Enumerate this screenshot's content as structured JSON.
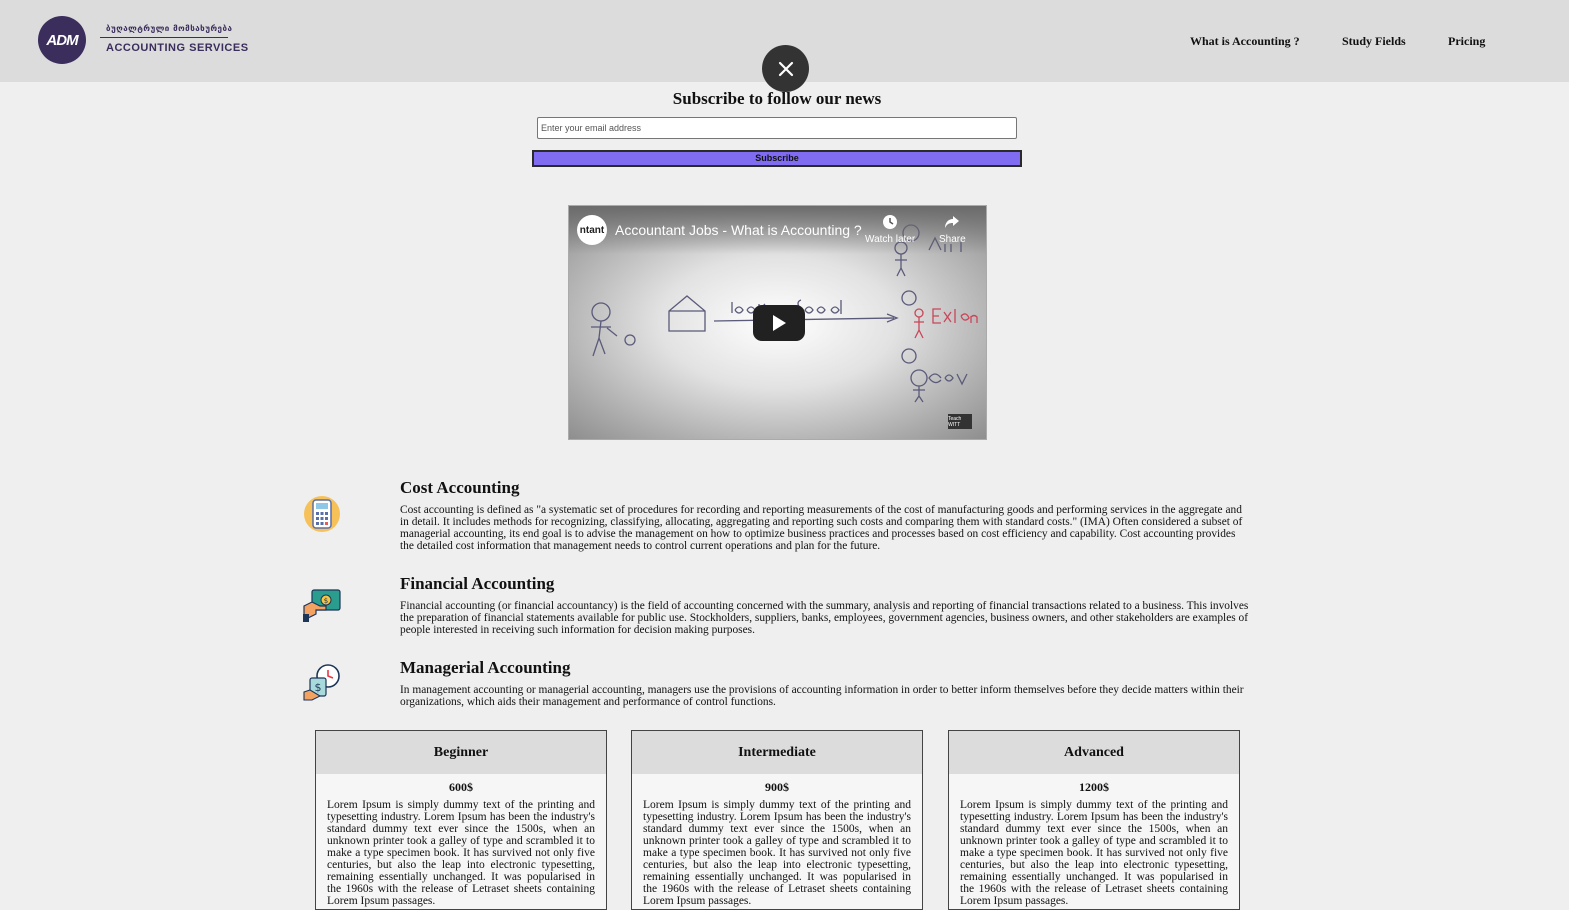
{
  "header": {
    "logo": {
      "mark": "ADM",
      "georgian_text": "ბუღალტრული მომსახურება",
      "services_text": "ACCOUNTING  SERVICES"
    },
    "nav": [
      {
        "label": "What is Accounting ?"
      },
      {
        "label": "Study Fields"
      },
      {
        "label": "Pricing"
      }
    ]
  },
  "subscribe": {
    "title": "Subscribe to follow our news",
    "email_placeholder": "Enter your email address",
    "button_label": "Subscribe"
  },
  "video": {
    "channel_icon_text": "ntant",
    "title": "Accountant Jobs - What is Accounting ?",
    "watch_later_label": "Watch later",
    "share_label": "Share",
    "watermark_text": "Teach WITT"
  },
  "accounting_types": [
    {
      "icon": "calculator-icon",
      "title": "Cost Accounting",
      "text": "Cost accounting is defined as \"a systematic set of procedures for recording and reporting measurements of the cost of manufacturing goods and performing services in the aggregate and in detail. It includes methods for recognizing, classifying, allocating, aggregating and reporting such costs and comparing them with standard costs.\" (IMA) Often considered a subset of managerial accounting, its end goal is to advise the management on how to optimize business practices and processes based on cost efficiency and capability. Cost accounting provides the detailed cost information that management needs to control current operations and plan for the future."
    },
    {
      "icon": "money-hand-icon",
      "title": "Financial Accounting",
      "text": "Financial accounting (or financial accountancy) is the field of accounting concerned with the summary, analysis and reporting of financial transactions related to a business. This involves the preparation of financial statements available for public use. Stockholders, suppliers, banks, employees, government agencies, business owners, and other stakeholders are examples of people interested in receiving such information for decision making purposes."
    },
    {
      "icon": "money-clock-icon",
      "title": "Managerial Accounting",
      "text": "In management accounting or managerial accounting, managers use the provisions of accounting information in order to better inform themselves before they decide matters within their organizations, which aids their management and performance of control functions."
    }
  ],
  "pricing": [
    {
      "name": "Beginner",
      "price": "600$",
      "text": "Lorem Ipsum is simply dummy text of the printing and typesetting industry. Lorem Ipsum has been the industry's standard dummy text ever since the 1500s, when an unknown printer took a galley of type and scrambled it to make a type specimen book. It has survived not only five centuries, but also the leap into electronic typesetting, remaining essentially unchanged. It was popularised in the 1960s with the release of Letraset sheets containing Lorem Ipsum passages."
    },
    {
      "name": "Intermediate",
      "price": "900$",
      "text": "Lorem Ipsum is simply dummy text of the printing and typesetting industry. Lorem Ipsum has been the industry's standard dummy text ever since the 1500s, when an unknown printer took a galley of type and scrambled it to make a type specimen book. It has survived not only five centuries, but also the leap into electronic typesetting, remaining essentially unchanged. It was popularised in the 1960s with the release of Letraset sheets containing Lorem Ipsum passages."
    },
    {
      "name": "Advanced",
      "price": "1200$",
      "text": "Lorem Ipsum is simply dummy text of the printing and typesetting industry. Lorem Ipsum has been the industry's standard dummy text ever since the 1500s, when an unknown printer took a galley of type and scrambled it to make a type specimen book. It has survived not only five centuries, but also the leap into electronic typesetting, remaining essentially unchanged. It was popularised in the 1960s with the release of Letraset sheets containing Lorem Ipsum passages."
    }
  ]
}
